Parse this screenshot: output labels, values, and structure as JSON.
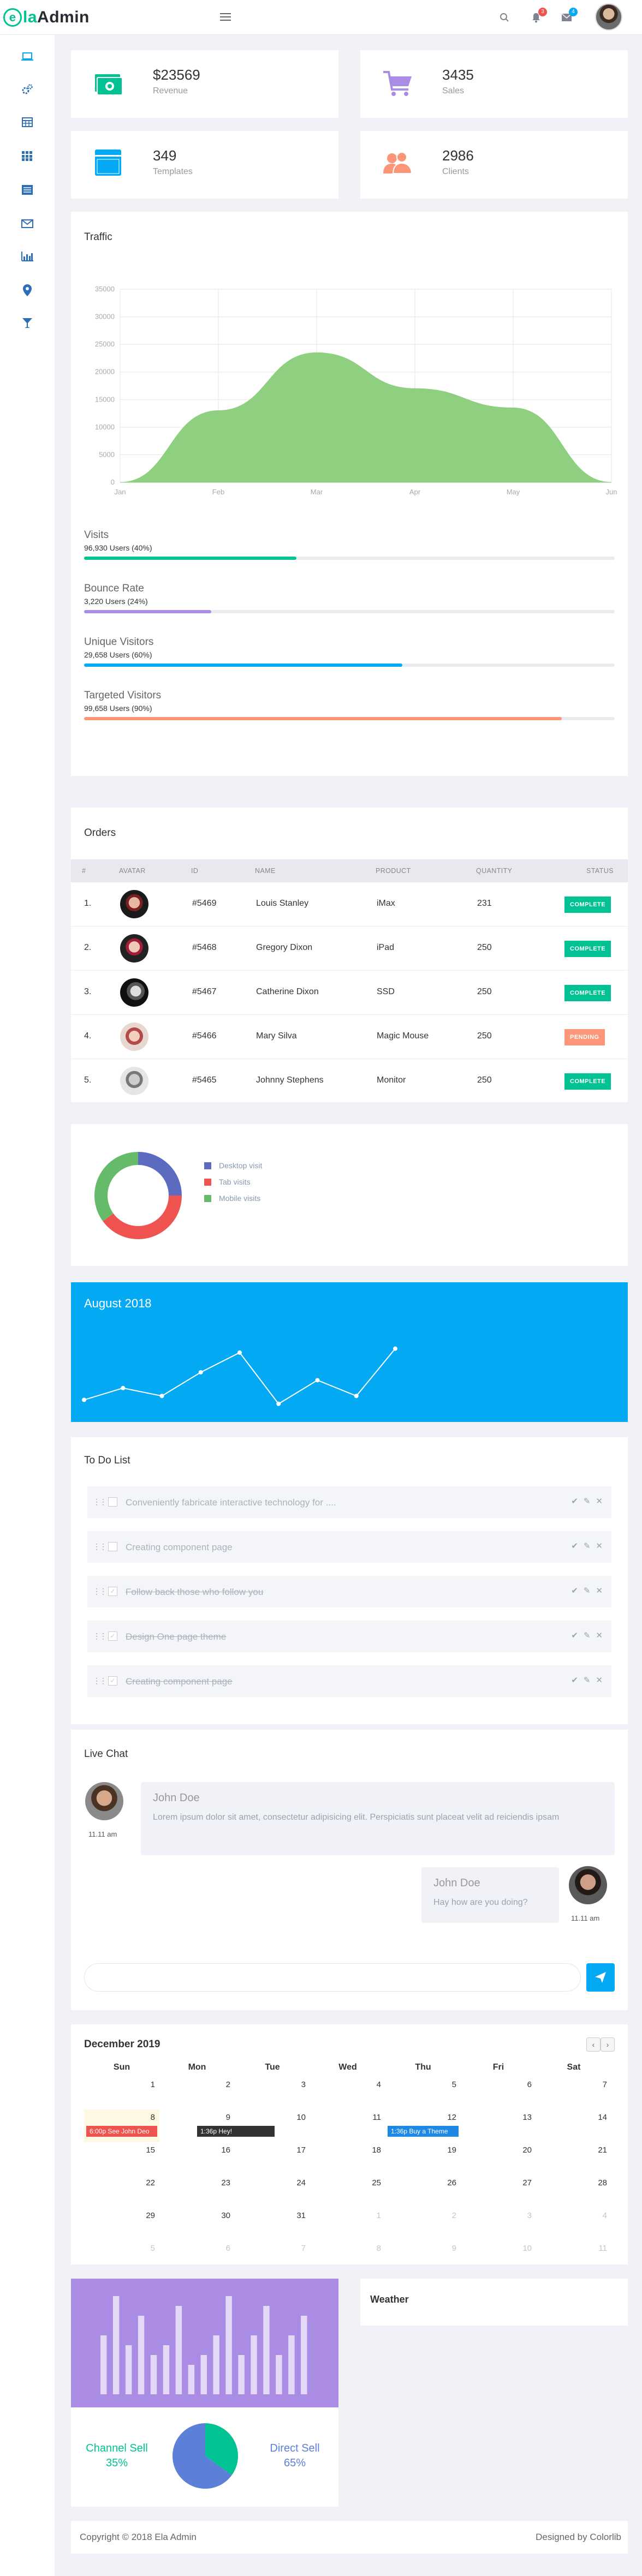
{
  "brand": {
    "mark": "e",
    "name_accent": "la",
    "name_dark": "Admin",
    "accent": "#00c292"
  },
  "header": {
    "notifications_count": "3",
    "messages_count": "4"
  },
  "stats": [
    {
      "value": "$23569",
      "label": "Revenue",
      "icon": "money-icon",
      "color": "#00c292"
    },
    {
      "value": "3435",
      "label": "Sales",
      "icon": "cart-icon",
      "color": "#ab8ce4"
    },
    {
      "value": "349",
      "label": "Templates",
      "icon": "browser-icon",
      "color": "#03a9f3"
    },
    {
      "value": "2986",
      "label": "Clients",
      "icon": "users-icon",
      "color": "#fb9678"
    }
  ],
  "traffic": {
    "title": "Traffic",
    "chart_data": {
      "type": "area",
      "x": [
        "Jan",
        "Feb",
        "Mar",
        "Apr",
        "May",
        "Jun"
      ],
      "values": [
        0,
        13000,
        23500,
        17000,
        13500,
        0
      ],
      "ylim": [
        0,
        35000
      ],
      "yticks": [
        0,
        5000,
        10000,
        15000,
        20000,
        25000,
        30000,
        35000
      ],
      "grid": true,
      "color": "#8ecf80"
    },
    "progress": [
      {
        "title": "Visits",
        "sub": "96,930 Users (40%)",
        "percent": 40,
        "color": "#00c292"
      },
      {
        "title": "Bounce Rate",
        "sub": "3,220 Users (24%)",
        "percent": 24,
        "color": "#ab8ce4"
      },
      {
        "title": "Unique Visitors",
        "sub": "29,658 Users (60%)",
        "percent": 60,
        "color": "#03a9f3"
      },
      {
        "title": "Targeted Visitors",
        "sub": "99,658 Users (90%)",
        "percent": 90,
        "color": "#fb9678"
      }
    ]
  },
  "orders": {
    "title": "Orders",
    "columns": [
      "#",
      "AVATAR",
      "ID",
      "NAME",
      "PRODUCT",
      "QUANTITY",
      "STATUS"
    ],
    "rows": [
      {
        "num": "1.",
        "id": "#5469",
        "name": "Louis Stanley",
        "product": "iMax",
        "qty": "231",
        "status": "COMPLETE",
        "status_color": "#00c292"
      },
      {
        "num": "2.",
        "id": "#5468",
        "name": "Gregory Dixon",
        "product": "iPad",
        "qty": "250",
        "status": "COMPLETE",
        "status_color": "#00c292"
      },
      {
        "num": "3.",
        "id": "#5467",
        "name": "Catherine Dixon",
        "product": "SSD",
        "qty": "250",
        "status": "COMPLETE",
        "status_color": "#00c292"
      },
      {
        "num": "4.",
        "id": "#5466",
        "name": "Mary Silva",
        "product": "Magic Mouse",
        "qty": "250",
        "status": "PENDING",
        "status_color": "#fb9678"
      },
      {
        "num": "5.",
        "id": "#5465",
        "name": "Johnny Stephens",
        "product": "Monitor",
        "qty": "250",
        "status": "COMPLETE",
        "status_color": "#00c292"
      }
    ]
  },
  "visits_donut": {
    "chart_data": {
      "type": "pie",
      "labels": [
        "Desktop visit",
        "Tab visits",
        "Mobile visits"
      ],
      "values": [
        25,
        40,
        35
      ],
      "colors": [
        "#5c6bc0",
        "#ef5350",
        "#66bb6a"
      ]
    }
  },
  "month_chart": {
    "title": "August 2018",
    "chart_data": {
      "type": "line",
      "values": [
        2,
        5,
        3,
        9,
        14,
        1,
        7,
        3,
        15
      ],
      "ylim": [
        0,
        18
      ],
      "color": "#ffffff"
    }
  },
  "todo": {
    "title": "To Do List",
    "items": [
      {
        "text": "Conveniently fabricate interactive technology for ....",
        "done": false
      },
      {
        "text": "Creating component page",
        "done": false
      },
      {
        "text": "Follow back those who follow you",
        "done": true
      },
      {
        "text": "Design One page theme",
        "done": true
      },
      {
        "text": "Creating component page",
        "done": true
      }
    ]
  },
  "chat": {
    "title": "Live Chat",
    "messages": [
      {
        "name": "John Doe",
        "text": "Lorem ipsum dolor sit amet, consectetur adipisicing elit. Perspiciatis sunt placeat velit ad reiciendis ipsam",
        "time": "11.11 am"
      },
      {
        "name": "John Doe",
        "text": "Hay how are you doing?",
        "time": "11.11 am"
      }
    ]
  },
  "calendar": {
    "title": "December 2019",
    "days": [
      "Sun",
      "Mon",
      "Tue",
      "Wed",
      "Thu",
      "Fri",
      "Sat"
    ],
    "weeks": [
      [
        "1",
        "2",
        "3",
        "4",
        "5",
        "6",
        "7"
      ],
      [
        "8",
        "9",
        "10",
        "11",
        "12",
        "13",
        "14"
      ],
      [
        "15",
        "16",
        "17",
        "18",
        "19",
        "20",
        "21"
      ],
      [
        "22",
        "23",
        "24",
        "25",
        "26",
        "27",
        "28"
      ],
      [
        "29",
        "30",
        "31",
        "1",
        "2",
        "3",
        "4"
      ],
      [
        "5",
        "6",
        "7",
        "8",
        "9",
        "10",
        "11"
      ]
    ],
    "events": [
      {
        "label": "6:00p See John Deo",
        "color": "#ef5350"
      },
      {
        "label": "1:36p Hey!",
        "color": "#333333"
      },
      {
        "label": "1:36p Buy a Theme",
        "color": "#1e88e5"
      }
    ]
  },
  "sales": {
    "bar_chart": {
      "type": "bar",
      "values": [
        6,
        10,
        5,
        8,
        4,
        5,
        9,
        3,
        4,
        6,
        10,
        4,
        6,
        9,
        4,
        6,
        8
      ],
      "color": "#e3d9f6"
    },
    "channel": {
      "label": "Channel Sell",
      "percent": "35%",
      "value": 35,
      "color": "#00c292"
    },
    "direct": {
      "label": "Direct Sell",
      "percent": "65%",
      "value": 65,
      "color": "#5c7fd8"
    }
  },
  "weather": {
    "title": "Weather"
  },
  "footer": {
    "copyright": "Copyright © 2018 Ela Admin",
    "credit_prefix": "Designed by ",
    "credit_link": "Colorlib"
  }
}
